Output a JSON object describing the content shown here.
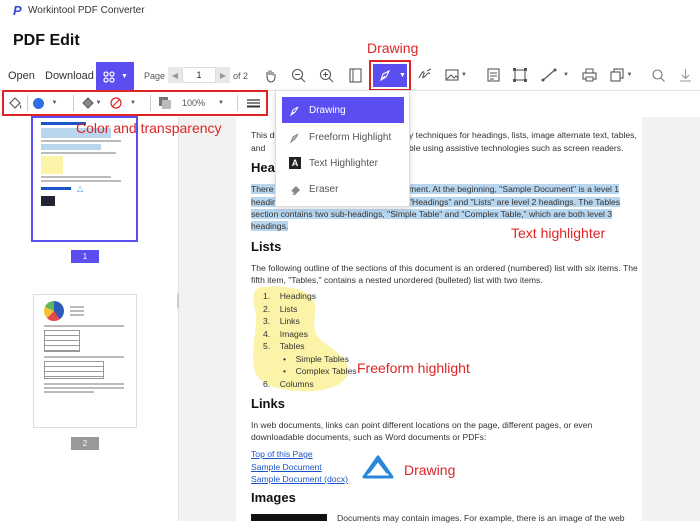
{
  "window_title": "Workintool PDF Converter",
  "page_title": "PDF Edit",
  "toolbar": {
    "open": "Open",
    "download": "Download",
    "page_label": "Page",
    "page_value": "1",
    "page_of": "of 2",
    "zoom": "100%"
  },
  "annotations": {
    "drawing_top": "Drawing",
    "color_transparency": "Color and transparency",
    "text_highlighter": "Text highlighter",
    "freeform_highlight": "Freeform highlight",
    "drawing_bottom": "Drawing"
  },
  "draw_menu": {
    "items": [
      "Drawing",
      "Freeform Highlight",
      "Text Highlighter",
      "Eraser"
    ]
  },
  "thumbnails": [
    {
      "number": "1"
    },
    {
      "number": "2"
    }
  ],
  "document": {
    "intro_frag1": "This do",
    "intro_frag2": "y techniques for headings, lists, image alternate text, tables,",
    "intro_frag3": "and",
    "intro_frag4": "ble using assistive technologies such as screen readers.",
    "heading_frag": "Hea",
    "hl_l1a": "There a",
    "hl_l1b": "ment. At the beginning, \"Sample Document\" is a level 1",
    "hl_l2a": "headin",
    "hl_l2b": "\"Headings\" and \"Lists\" are level 2 headings. The Tables",
    "hl_l3": "section contains two sub-headings, \"Simple Table\" and \"Complex Table,\" which are both level 3",
    "hl_l4": "headings.",
    "lists_heading": "Lists",
    "lists_p1": "The following outline of the sections of this document is an ordered (numbered) list with six items. The",
    "lists_p2": "fifth item, \"Tables,\" contains a nested unordered (bulleted) list with two items.",
    "ol": [
      "Headings",
      "Lists",
      "Links",
      "Images",
      "Tables",
      "Columns"
    ],
    "ul": [
      "Simple Tables",
      "Complex Tables"
    ],
    "links_heading": "Links",
    "links_p1": "In web documents, links can point different locations on the page, different pages, or even",
    "links_p2": "downloadable documents, such as Word documents or PDFs:",
    "links": [
      "Top of this Page",
      "Sample Document",
      "Sample Document (docx)"
    ],
    "images_heading": "Images",
    "images_p": "Documents may contain images. For example, there is an image of the web"
  },
  "colors": {
    "accent": "#5b4ef0",
    "annotation_red": "#e02424",
    "highlight": "#b9d6ef",
    "freeform": "#fbf3a8"
  }
}
